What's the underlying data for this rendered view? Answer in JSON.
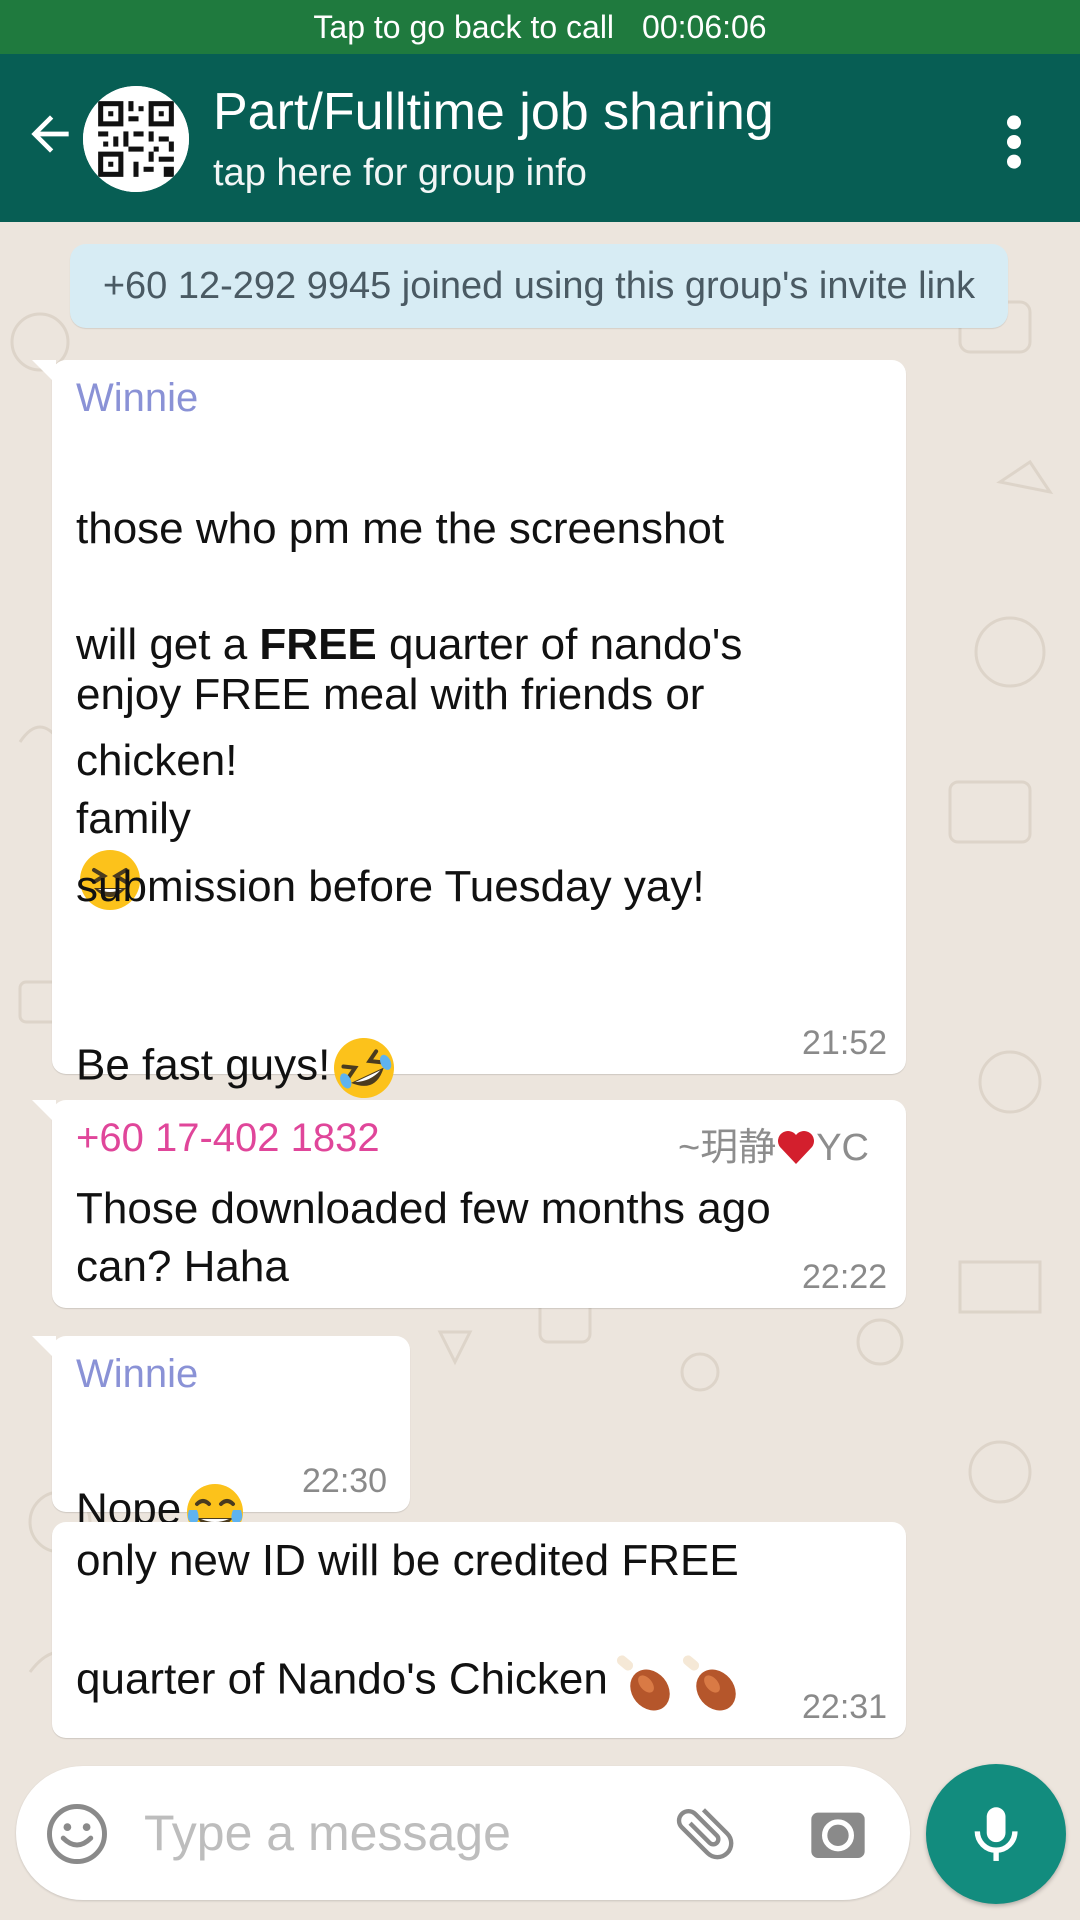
{
  "call_bar": {
    "text": "Tap to go back to call",
    "duration": "00:06:06"
  },
  "header": {
    "title": "Part/Fulltime job sharing",
    "subtitle": "tap here for group info"
  },
  "system_message": "+60 12-292 9945 joined using this group's invite link",
  "messages": [
    {
      "sender": "Winnie",
      "line1": "those who pm me the screenshot",
      "line2_pre": "will get a ",
      "line2_bold": "FREE",
      "line2_post": " quarter of nando's",
      "line3": "chicken!",
      "line4": "enjoy FREE meal with friends or",
      "line5": "family",
      "line6": "submission before Tuesday yay!",
      "line7": "Be fast guys!",
      "time": "21:52"
    },
    {
      "sender": "+60 17-402 1832",
      "push_name_pre": "~玥静",
      "push_name_post": "YC",
      "text": "Those downloaded few months ago\ncan? Haha",
      "time": "22:22"
    },
    {
      "sender": "Winnie",
      "text": "Nope",
      "time": "22:30"
    },
    {
      "line1": "only new ID will be credited FREE",
      "line2": "quarter of Nando's Chicken",
      "time": "22:31"
    }
  ],
  "input": {
    "placeholder": "Type a message"
  },
  "colors": {
    "header": "#075e54",
    "call_bar": "#1f7a3e",
    "mic": "#128c7e",
    "sender_winnie": "#8a92d6",
    "sender_phone": "#e0469a",
    "system_bg": "#d7ecf4"
  },
  "icons": [
    "back-arrow-icon",
    "group-avatar",
    "more-vert-icon",
    "grinning-squinting-emoji",
    "rolling-laughing-emoji",
    "heart-emoji",
    "tears-of-joy-emoji",
    "poultry-leg-emoji",
    "smiley-icon",
    "attach-icon",
    "camera-icon",
    "mic-icon"
  ]
}
